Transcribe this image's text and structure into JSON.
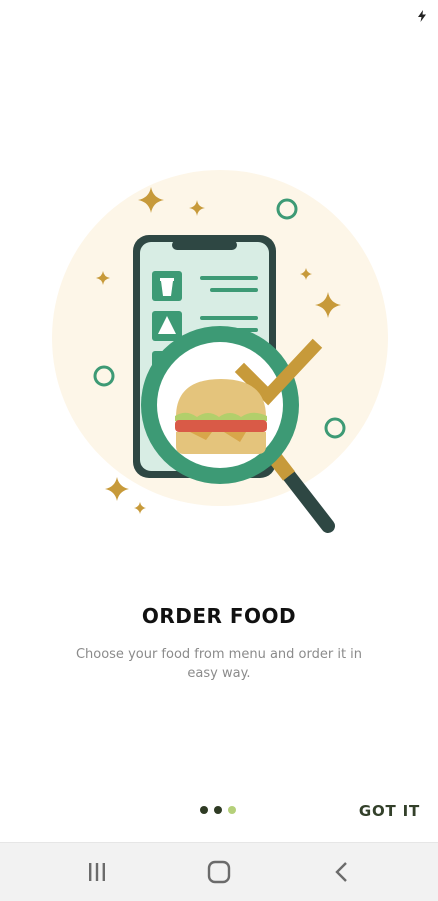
{
  "onboarding": {
    "title": "ORDER FOOD",
    "description": "Choose your food from menu and order it in easy way.",
    "got_it_label": "GOT IT",
    "page_indicator": {
      "total": 3,
      "current": 3
    },
    "illustration": {
      "subject": "phone menu with magnifying glass over burger",
      "icons": [
        "sparkle-icon",
        "phone-icon",
        "drink-icon",
        "watermelon-icon",
        "magnifying-glass-icon",
        "burger-icon",
        "checkmark-icon"
      ]
    }
  },
  "status_bar": {
    "icons": [
      "charging-bolt-icon"
    ]
  },
  "nav_bar": {
    "buttons": [
      "recent-apps-icon",
      "home-icon",
      "back-icon"
    ]
  },
  "colors": {
    "accent_green": "#3d9a75",
    "dark_slate": "#2e4743",
    "gold": "#c79a3a",
    "halo": "#fdf6e8",
    "dot_active": "#b5d07a",
    "dot_inactive": "#2f3b24"
  }
}
